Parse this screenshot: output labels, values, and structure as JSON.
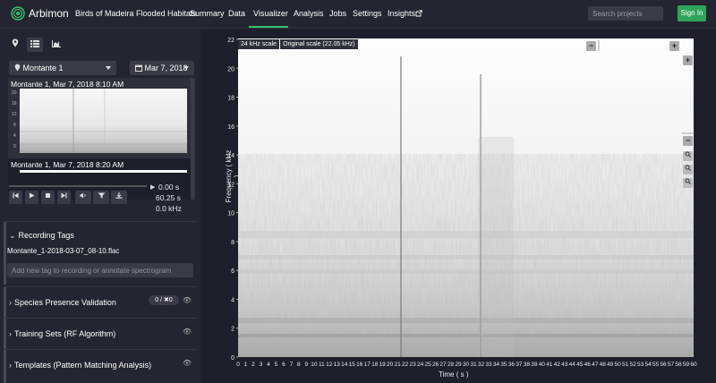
{
  "app": {
    "name": "Arbimon",
    "project": "Birds of Madeira Flooded Habitats",
    "nav": [
      "Summary",
      "Data",
      "Visualizer",
      "Analysis",
      "Jobs",
      "Settings",
      "Insights"
    ],
    "active_nav": "Visualizer",
    "search_placeholder": "Search projects",
    "signin_label": "Sign In",
    "accent_color": "#30c36e"
  },
  "sidebar": {
    "tool_icons": [
      "map-marker-icon",
      "list-icon",
      "chart-icon"
    ],
    "site_select": "Montante 1",
    "date_select": "Mar 7, 2018",
    "recordings": [
      {
        "title": "Montante 1, Mar 7, 2018 8:10 AM"
      },
      {
        "title": "Montante 1, Mar 7, 2018 8:20 AM"
      }
    ],
    "thumb_yticks": [
      "20",
      "16",
      "12",
      "8",
      "4",
      "0"
    ],
    "player": {
      "time": "0.00 s",
      "duration": "60.25 s",
      "freq": "0.0 kHz"
    },
    "tags_section": "Recording Tags",
    "tag_file": "Montante_1-2018-03-07_08-10.flac",
    "tag_placeholder": "Add new tag to recording or annotate spectrogram",
    "sections": [
      {
        "label": "Species Presence Validation",
        "badge": "0 / ✖0"
      },
      {
        "label": "Training Sets (RF Algorithm)"
      },
      {
        "label": "Templates (Pattern Matching Analysis)"
      }
    ]
  },
  "visualizer": {
    "scale_badges": [
      "24 kHz scale",
      "Original scale (22.05 kHz)"
    ],
    "y_axis_label": "Frequency ( kHz )",
    "x_axis_label": "Time ( s )",
    "y_ticks": [
      "22",
      "20",
      "18",
      "16",
      "14",
      "12",
      "10",
      "8",
      "6",
      "4",
      "2",
      "0"
    ],
    "x_ticks": [
      "0",
      "1",
      "2",
      "3",
      "4",
      "5",
      "6",
      "7",
      "8",
      "9",
      "10",
      "11",
      "12",
      "13",
      "14",
      "15",
      "16",
      "17",
      "18",
      "19",
      "20",
      "21",
      "22",
      "23",
      "24",
      "25",
      "26",
      "27",
      "28",
      "29",
      "30",
      "31",
      "32",
      "33",
      "34",
      "35",
      "36",
      "37",
      "38",
      "39",
      "40",
      "41",
      "42",
      "43",
      "44",
      "45",
      "46",
      "47",
      "48",
      "49",
      "50",
      "51",
      "52",
      "53",
      "54",
      "55",
      "56",
      "57",
      "58",
      "59",
      "60"
    ]
  }
}
